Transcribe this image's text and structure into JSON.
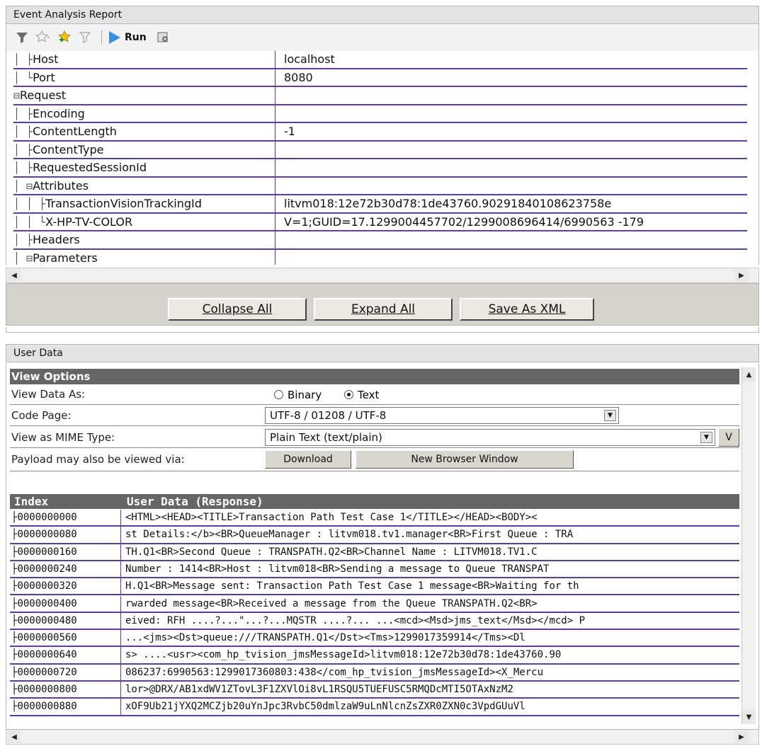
{
  "top_panel": {
    "title": "Event Analysis Report",
    "toolbar": {
      "run_label": "Run",
      "icons": [
        "filter-icon",
        "favorites-icon",
        "add-favorite-icon",
        "clear-filter-icon",
        "run-icon",
        "settings-icon"
      ]
    },
    "tree": [
      {
        "prefix": "│ ├",
        "name": "Host",
        "value": "localhost"
      },
      {
        "prefix": "│ └",
        "name": "Port",
        "value": "8080"
      },
      {
        "prefix": "⊟",
        "name": "Request",
        "value": ""
      },
      {
        "prefix": "│ ├",
        "name": "Encoding",
        "value": ""
      },
      {
        "prefix": "│ ├",
        "name": "ContentLength",
        "value": "-1"
      },
      {
        "prefix": "│ ├",
        "name": "ContentType",
        "value": ""
      },
      {
        "prefix": "│ ├",
        "name": "RequestedSessionId",
        "value": ""
      },
      {
        "prefix": "│ ⊟",
        "name": "Attributes",
        "value": ""
      },
      {
        "prefix": "│ │ ├",
        "name": "TransactionVisionTrackingId",
        "value": "litvm018:12e72b30d78:1de43760.90291840108623758e"
      },
      {
        "prefix": "│ │ └",
        "name": "X-HP-TV-COLOR",
        "value": "V=1;GUID=17.1299004457702/1299008696414/6990563 -179"
      },
      {
        "prefix": "│ ├",
        "name": "Headers",
        "value": ""
      },
      {
        "prefix": "│ ⊟",
        "name": "Parameters",
        "value": ""
      }
    ],
    "buttons": {
      "collapse": "Collapse All",
      "expand": "Expand All",
      "save_xml": "Save As XML"
    }
  },
  "user_data_panel": {
    "title": "User Data",
    "view_options": {
      "header": "View Options",
      "view_data_as_label": "View Data As:",
      "binary_label": "Binary",
      "text_label": "Text",
      "selected": "Text",
      "code_page_label": "Code Page:",
      "code_page_value": "UTF-8 / 01208 / UTF-8",
      "mime_label": "View as MIME Type:",
      "mime_value": "Plain Text (text/plain)",
      "mime_button_label": "V",
      "payload_label": "Payload may also be viewed via:",
      "download_label": "Download",
      "new_window_label": "New Browser Window"
    },
    "table": {
      "col_index": "Index",
      "col_data": "User Data (Response)",
      "rows": [
        {
          "index": "0000000000",
          "data": "<HTML><HEAD><TITLE>Transaction Path Test Case 1</TITLE></HEAD><BODY><"
        },
        {
          "index": "0000000080",
          "data": "st Details:</b><BR>QueueManager : litvm018.tv1.manager<BR>First Queue : TRA"
        },
        {
          "index": "0000000160",
          "data": "TH.Q1<BR>Second Queue : TRANSPATH.Q2<BR>Channel Name : LITVM018.TV1.C"
        },
        {
          "index": "0000000240",
          "data": "Number : 1414<BR>Host : litvm018<BR>Sending a message to Queue TRANSPAT"
        },
        {
          "index": "0000000320",
          "data": "H.Q1<BR>Message sent: Transaction Path Test Case 1 message<BR>Waiting for th"
        },
        {
          "index": "0000000400",
          "data": "rwarded message<BR>Received a message from the Queue TRANSPATH.Q2<BR>"
        },
        {
          "index": "0000000480",
          "data": "eived: RFH ....?...\"...?...MQSTR ....?... ...<mcd><Msd>jms_text</Msd></mcd> P"
        },
        {
          "index": "0000000560",
          "data": "...<jms><Dst>queue:///TRANSPATH.Q1</Dst><Tms>1299017359914</Tms><Dl"
        },
        {
          "index": "0000000640",
          "data": "s> ....<usr><com_hp_tvision_jmsMessageId>litvm018:12e72b30d78:1de43760.90"
        },
        {
          "index": "0000000720",
          "data": "086237:6990563:1299017360803:438</com_hp_tvision_jmsMessageId><X_Mercu"
        },
        {
          "index": "0000000800",
          "data": "lor>@DRX/AB1xdWV1ZTovL3F1ZXVlOi8vL1RSQU5TUEFUSC5RMQDcMTI5OTAxNzM2"
        },
        {
          "index": "0000000880",
          "data": "xOF9Ub21jYXQ2MCZjb20uYnJpc3RvbC50dmlzaW9uLnNlcnZsZXR0ZXN0c3VpdGUuVl"
        }
      ]
    }
  }
}
